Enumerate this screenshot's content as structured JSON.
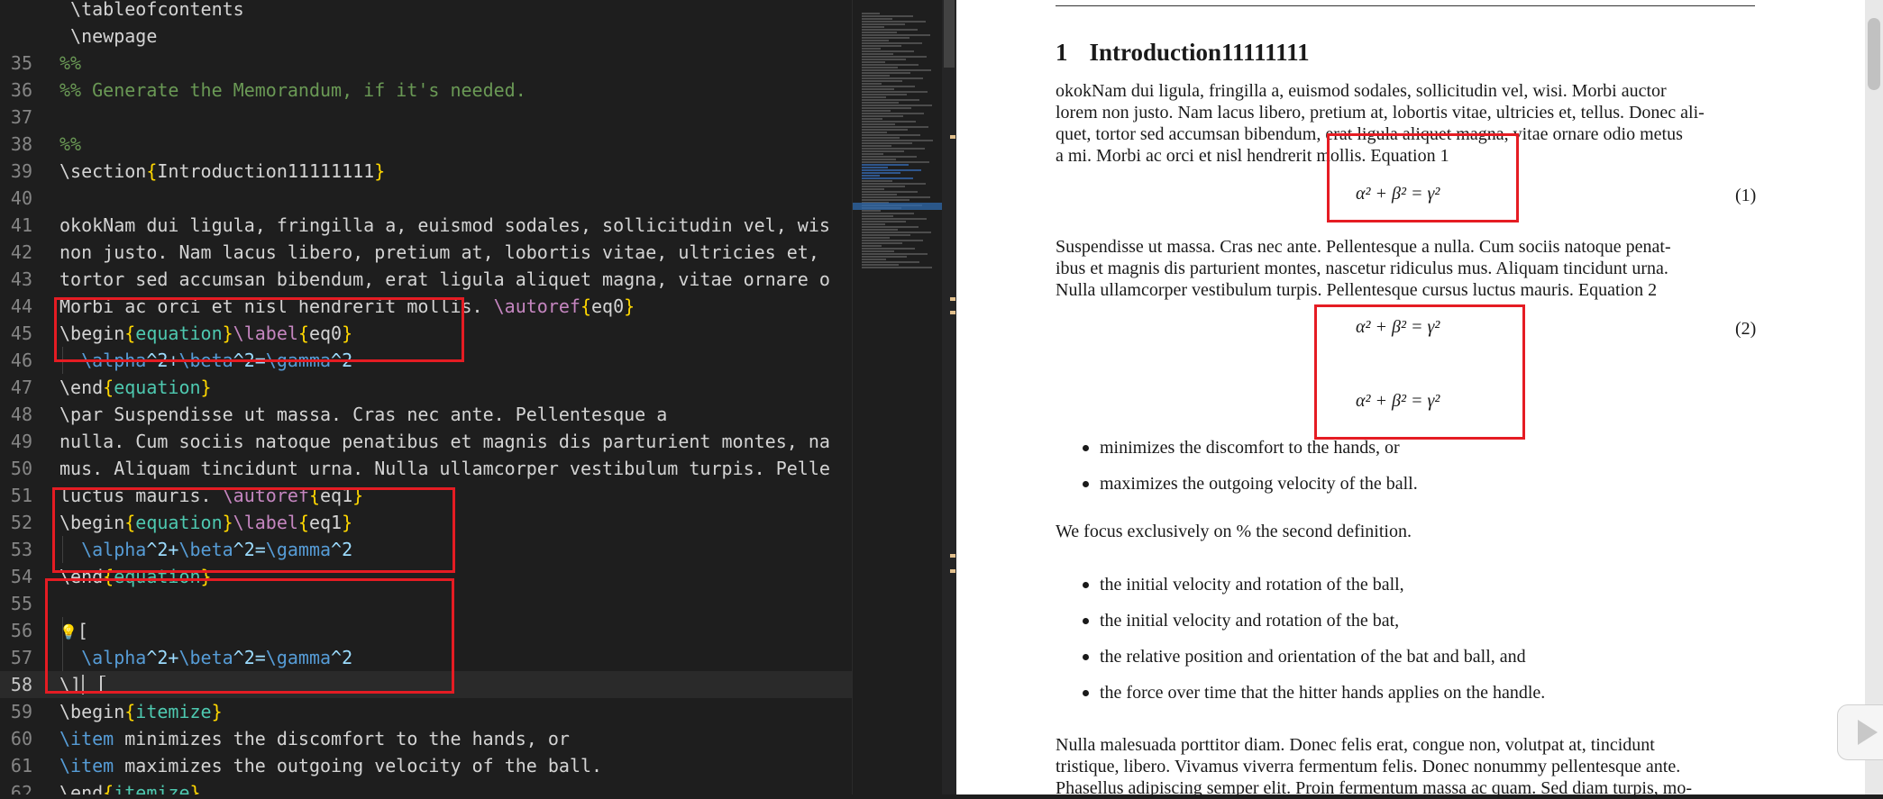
{
  "editor": {
    "active_line": "58",
    "lines": [
      {
        "n": "",
        "parts": [
          {
            "c": "cmd",
            "t": " \\tableofcontents"
          }
        ]
      },
      {
        "n": "",
        "parts": [
          {
            "c": "cmd",
            "t": " \\newpage"
          }
        ]
      },
      {
        "n": "35",
        "parts": [
          {
            "c": "cmt",
            "t": "%%"
          }
        ]
      },
      {
        "n": "36",
        "parts": [
          {
            "c": "cmt",
            "t": "%% Generate the Memorandum, if it's needed."
          }
        ]
      },
      {
        "n": "37",
        "parts": []
      },
      {
        "n": "38",
        "parts": [
          {
            "c": "cmt",
            "t": "%%"
          }
        ]
      },
      {
        "n": "39",
        "parts": [
          {
            "c": "cmd",
            "t": "\\section"
          },
          {
            "c": "brace",
            "t": "{"
          },
          {
            "c": "cmd",
            "t": "Introduction11111111"
          },
          {
            "c": "brace",
            "t": "}"
          }
        ]
      },
      {
        "n": "40",
        "parts": []
      },
      {
        "n": "41",
        "parts": [
          {
            "c": "cmd",
            "t": "okokNam dui ligula, fringilla a, euismod sodales, sollicitudin vel, wis"
          }
        ]
      },
      {
        "n": "42",
        "parts": [
          {
            "c": "cmd",
            "t": "non justo. Nam lacus libero, pretium at, lobortis vitae, ultricies et,"
          }
        ]
      },
      {
        "n": "43",
        "parts": [
          {
            "c": "cmd",
            "t": "tortor sed accumsan bibendum, erat ligula aliquet magna, vitae ornare o"
          }
        ]
      },
      {
        "n": "44",
        "parts": [
          {
            "c": "cmd",
            "t": "Morbi ac orci et nisl hendrerit mollis. "
          },
          {
            "c": "lbl",
            "t": "\\autoref"
          },
          {
            "c": "brace",
            "t": "{"
          },
          {
            "c": "cmd",
            "t": "eq0"
          },
          {
            "c": "brace",
            "t": "}"
          }
        ]
      },
      {
        "n": "45",
        "parts": [
          {
            "c": "cmd",
            "t": "\\begin"
          },
          {
            "c": "brace",
            "t": "{"
          },
          {
            "c": "env",
            "t": "equation"
          },
          {
            "c": "brace",
            "t": "}"
          },
          {
            "c": "lbl",
            "t": "\\label"
          },
          {
            "c": "brace",
            "t": "{"
          },
          {
            "c": "cmd",
            "t": "eq0"
          },
          {
            "c": "brace",
            "t": "}"
          }
        ]
      },
      {
        "n": "46",
        "parts": [
          {
            "c": "cmd2",
            "t": "  \\alpha"
          },
          {
            "c": "eqc",
            "t": "^2+"
          },
          {
            "c": "cmd2",
            "t": "\\beta"
          },
          {
            "c": "eqc",
            "t": "^2="
          },
          {
            "c": "cmd2",
            "t": "\\gamma"
          },
          {
            "c": "eqc",
            "t": "^2"
          }
        ]
      },
      {
        "n": "47",
        "parts": [
          {
            "c": "cmd",
            "t": "\\end"
          },
          {
            "c": "brace",
            "t": "{"
          },
          {
            "c": "env",
            "t": "equation"
          },
          {
            "c": "brace",
            "t": "}"
          }
        ]
      },
      {
        "n": "48",
        "parts": [
          {
            "c": "cmd",
            "t": "\\par Suspendisse ut massa. Cras nec ante. Pellentesque a"
          }
        ]
      },
      {
        "n": "49",
        "parts": [
          {
            "c": "cmd",
            "t": "nulla. Cum sociis natoque penatibus et magnis dis parturient montes, na"
          }
        ]
      },
      {
        "n": "50",
        "parts": [
          {
            "c": "cmd",
            "t": "mus. Aliquam tincidunt urna. Nulla ullamcorper vestibulum turpis. Pelle"
          }
        ]
      },
      {
        "n": "51",
        "parts": [
          {
            "c": "cmd",
            "t": "luctus mauris. "
          },
          {
            "c": "lbl",
            "t": "\\autoref"
          },
          {
            "c": "brace",
            "t": "{"
          },
          {
            "c": "cmd",
            "t": "eq1"
          },
          {
            "c": "brace",
            "t": "}"
          }
        ]
      },
      {
        "n": "52",
        "parts": [
          {
            "c": "cmd",
            "t": "\\begin"
          },
          {
            "c": "brace",
            "t": "{"
          },
          {
            "c": "env",
            "t": "equation"
          },
          {
            "c": "brace",
            "t": "}"
          },
          {
            "c": "lbl",
            "t": "\\label"
          },
          {
            "c": "brace",
            "t": "{"
          },
          {
            "c": "cmd",
            "t": "eq1"
          },
          {
            "c": "brace",
            "t": "}"
          }
        ]
      },
      {
        "n": "53",
        "parts": [
          {
            "c": "cmd2",
            "t": "  \\alpha"
          },
          {
            "c": "eqc",
            "t": "^2+"
          },
          {
            "c": "cmd2",
            "t": "\\beta"
          },
          {
            "c": "eqc",
            "t": "^2="
          },
          {
            "c": "cmd2",
            "t": "\\gamma"
          },
          {
            "c": "eqc",
            "t": "^2"
          }
        ]
      },
      {
        "n": "54",
        "parts": [
          {
            "c": "cmd",
            "t": "\\end"
          },
          {
            "c": "brace",
            "t": "{"
          },
          {
            "c": "env",
            "t": "equation"
          },
          {
            "c": "brace",
            "t": "}"
          }
        ]
      },
      {
        "n": "55",
        "parts": []
      },
      {
        "n": "56",
        "parts": [
          {
            "c": "bulb",
            "t": "💡"
          },
          {
            "c": "cmd",
            "t": "["
          }
        ]
      },
      {
        "n": "57",
        "parts": [
          {
            "c": "cmd2",
            "t": "  \\alpha"
          },
          {
            "c": "eqc",
            "t": "^2+"
          },
          {
            "c": "cmd2",
            "t": "\\beta"
          },
          {
            "c": "eqc",
            "t": "^2="
          },
          {
            "c": "cmd2",
            "t": "\\gamma"
          },
          {
            "c": "eqc",
            "t": "^2"
          }
        ]
      },
      {
        "n": "58",
        "parts": [
          {
            "c": "cmd",
            "t": "\\]"
          }
        ]
      },
      {
        "n": "59",
        "parts": [
          {
            "c": "cmd",
            "t": "\\begin"
          },
          {
            "c": "brace",
            "t": "{"
          },
          {
            "c": "env",
            "t": "itemize"
          },
          {
            "c": "brace",
            "t": "}"
          }
        ]
      },
      {
        "n": "60",
        "parts": [
          {
            "c": "cmd2",
            "t": "\\item"
          },
          {
            "c": "cmd",
            "t": " minimizes the discomfort to the hands, or"
          }
        ]
      },
      {
        "n": "61",
        "parts": [
          {
            "c": "cmd2",
            "t": "\\item"
          },
          {
            "c": "cmd",
            "t": " maximizes the outgoing velocity of the ball."
          }
        ]
      },
      {
        "n": "62",
        "parts": [
          {
            "c": "cmd",
            "t": "\\end"
          },
          {
            "c": "brace",
            "t": "{"
          },
          {
            "c": "env",
            "t": "itemize"
          },
          {
            "c": "brace",
            "t": "}"
          }
        ]
      }
    ]
  },
  "pdf": {
    "section_num": "1",
    "section_title": "Introduction11111111",
    "para1": [
      "okokNam dui ligula, fringilla a, euismod sodales, sollicitudin vel, wisi.  Morbi auctor",
      "lorem non justo. Nam lacus libero, pretium at, lobortis vitae, ultricies et, tellus. Donec ali-",
      "quet, tortor sed accumsan bibendum, erat ligula aliquet magna, vitae ornare odio metus",
      "a mi. Morbi ac orci et nisl hendrerit mollis. Equation 1"
    ],
    "eq_text": "α² + β² = γ²",
    "eq1_num": "(1)",
    "para2": [
      "     Suspendisse ut massa. Cras nec ante. Pellentesque a nulla. Cum sociis natoque penat-",
      "ibus et magnis dis parturient montes, nascetur ridiculus mus.  Aliquam tincidunt urna.",
      "Nulla ullamcorper vestibulum turpis. Pellentesque cursus luctus mauris. Equation 2"
    ],
    "eq2_num": "(2)",
    "bullets1": [
      "minimizes the discomfort to the hands, or",
      "maximizes the outgoing velocity of the ball."
    ],
    "focus": "We focus exclusively on % the second definition.",
    "bullets2": [
      "the initial velocity and rotation of the ball,",
      "the initial velocity and rotation of the bat,",
      "the relative position and orientation of the bat and ball, and",
      "the force over time that the hitter hands applies on the handle."
    ],
    "para3": [
      "Nulla malesuada porttitor diam.  Donec felis erat, congue non, volutpat at, tincidunt",
      "tristique, libero.  Vivamus viverra fermentum felis.  Donec nonummy pellentesque ante.",
      "Phasellus adipiscing semper elit. Proin fermentum massa ac quam. Sed diam turpis, mo-"
    ]
  },
  "colors": {
    "highlight_box": "#e51c23",
    "editor_bg": "#1e1e1e",
    "pdf_bg": "#ffffff"
  },
  "icons": {
    "lightbulb": "lightbulb-icon",
    "text_cursor": "text-cursor-icon",
    "play": "play-icon"
  }
}
